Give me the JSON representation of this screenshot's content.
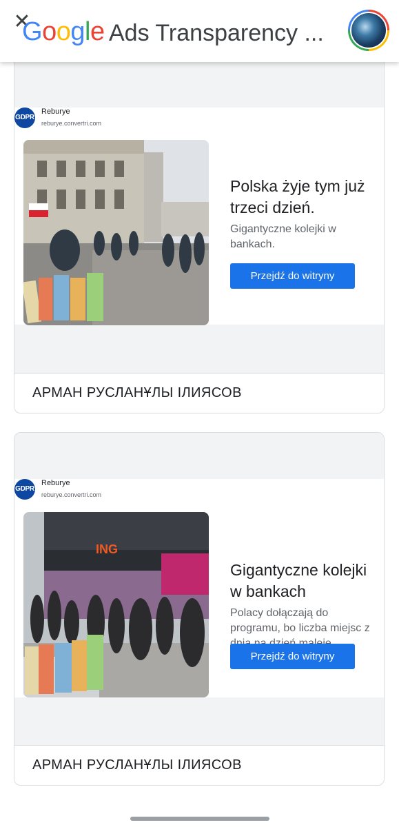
{
  "header": {
    "close_icon": "close-icon",
    "logo_letters": [
      {
        "ch": "G",
        "color": "#4285f4"
      },
      {
        "ch": "o",
        "color": "#ea4335"
      },
      {
        "ch": "o",
        "color": "#fbbc04"
      },
      {
        "ch": "g",
        "color": "#4285f4"
      },
      {
        "ch": "l",
        "color": "#34a853"
      },
      {
        "ch": "e",
        "color": "#ea4335"
      }
    ],
    "title": "Ads Transparency ...",
    "avatar_icon": "account-avatar"
  },
  "ads": [
    {
      "gdpr_badge": "GDPR",
      "advertiser_display": "Reburye",
      "url": "reburye.convertri.com",
      "headline": "Polska żyje tym już trzeci dzień.",
      "description": "Gigantyczne kolejki w bankach.",
      "cta": "Przejdź do witryny",
      "advertiser": "АРМАН РУСЛАНҰЛЫ ІЛИЯСОВ"
    },
    {
      "gdpr_badge": "GDPR",
      "advertiser_display": "Reburye",
      "url": "reburye.convertri.com",
      "headline": "Gigantyczne kolejki w bankach",
      "description": "Polacy dołączają do programu, bo liczba miejsc z dnia na dzień maleje.",
      "cta": "Przejdź do witryny",
      "advertiser": "АРМАН РУСЛАНҰЛЫ ІЛИЯСОВ",
      "image_sign": "ING"
    }
  ],
  "colors": {
    "accent": "#1a73e8",
    "preview_bg": "#f1f3f4",
    "gdpr": "#0d47a1"
  }
}
